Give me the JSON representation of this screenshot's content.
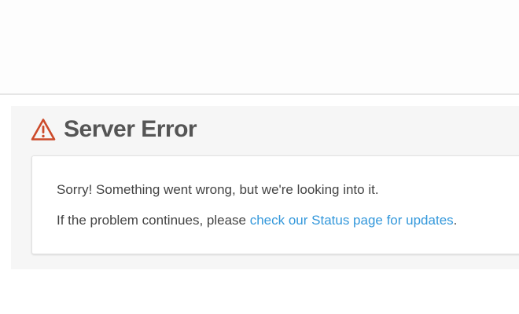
{
  "header": {
    "title": "Server Error",
    "icon": "warning-icon",
    "icon_color": "#cc4a2a"
  },
  "message": {
    "line1": "Sorry! Something went wrong, but we're looking into it.",
    "line2_prefix": "If the problem continues, please ",
    "status_link_text": "check our Status page for updates",
    "line2_suffix": "."
  },
  "colors": {
    "link": "#3498db",
    "title": "#555555",
    "text": "#444444"
  }
}
